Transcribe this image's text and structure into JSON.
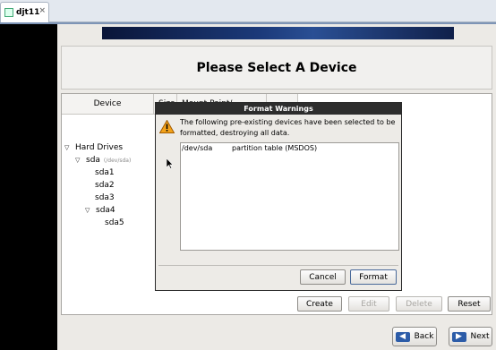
{
  "host": {
    "tab_title": "djt11",
    "tab_close": "×"
  },
  "page": {
    "title": "Please Select A Device"
  },
  "table": {
    "headers": [
      "Device",
      "Size",
      "Mount Point/",
      ""
    ]
  },
  "tree": {
    "hard_drives": "Hard Drives",
    "sda": "sda",
    "sda_path": "(/dev/sda)",
    "sda1": "sda1",
    "sda2": "sda2",
    "sda3": "sda3",
    "sda4": "sda4",
    "sda5": "sda5"
  },
  "dialog": {
    "title": "Format Warnings",
    "message": "The following pre-existing devices have been selected to be formatted, destroying all data.",
    "rows": [
      {
        "device": "/dev/sda",
        "description": "partition table (MSDOS)"
      }
    ],
    "cancel": "Cancel",
    "format": "Format"
  },
  "actions": {
    "create": "Create",
    "edit": "Edit",
    "delete": "Delete",
    "reset": "Reset"
  },
  "nav": {
    "back": "Back",
    "next": "Next"
  },
  "icons": {
    "warning": "warning-icon",
    "back": "back-arrow-icon",
    "next": "next-arrow-icon"
  }
}
